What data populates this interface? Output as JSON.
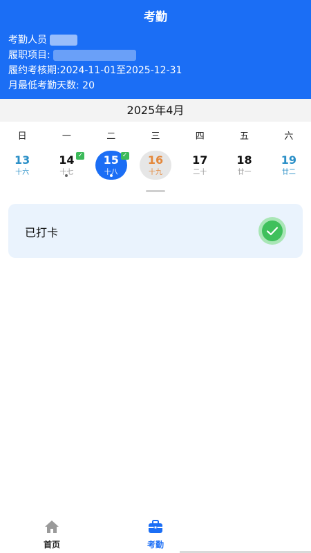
{
  "header": {
    "title": "考勤",
    "person_label": "考勤人员",
    "project_label": "履职项目:",
    "period_label": "履约考核期:",
    "period_value": "2024-11-01至2025-12-31",
    "min_days_label": "月最低考勤天数:",
    "min_days_value": "20"
  },
  "calendar": {
    "month": "2025年4月",
    "weekdays": [
      "日",
      "一",
      "二",
      "三",
      "四",
      "五",
      "六"
    ],
    "days": [
      {
        "num": "13",
        "lunar": "十六"
      },
      {
        "num": "14",
        "lunar": "十七"
      },
      {
        "num": "15",
        "lunar": "十八"
      },
      {
        "num": "16",
        "lunar": "十九"
      },
      {
        "num": "17",
        "lunar": "二十"
      },
      {
        "num": "18",
        "lunar": "廿一"
      },
      {
        "num": "19",
        "lunar": "廿二"
      }
    ]
  },
  "status_card": {
    "label": "已打卡"
  },
  "tabbar": {
    "home_label": "首页",
    "attendance_label": "考勤"
  },
  "colors": {
    "primary": "#1b6ef5",
    "weekend": "#2a8fc7",
    "today": "#e4873a",
    "checked": "#3fc05c"
  }
}
